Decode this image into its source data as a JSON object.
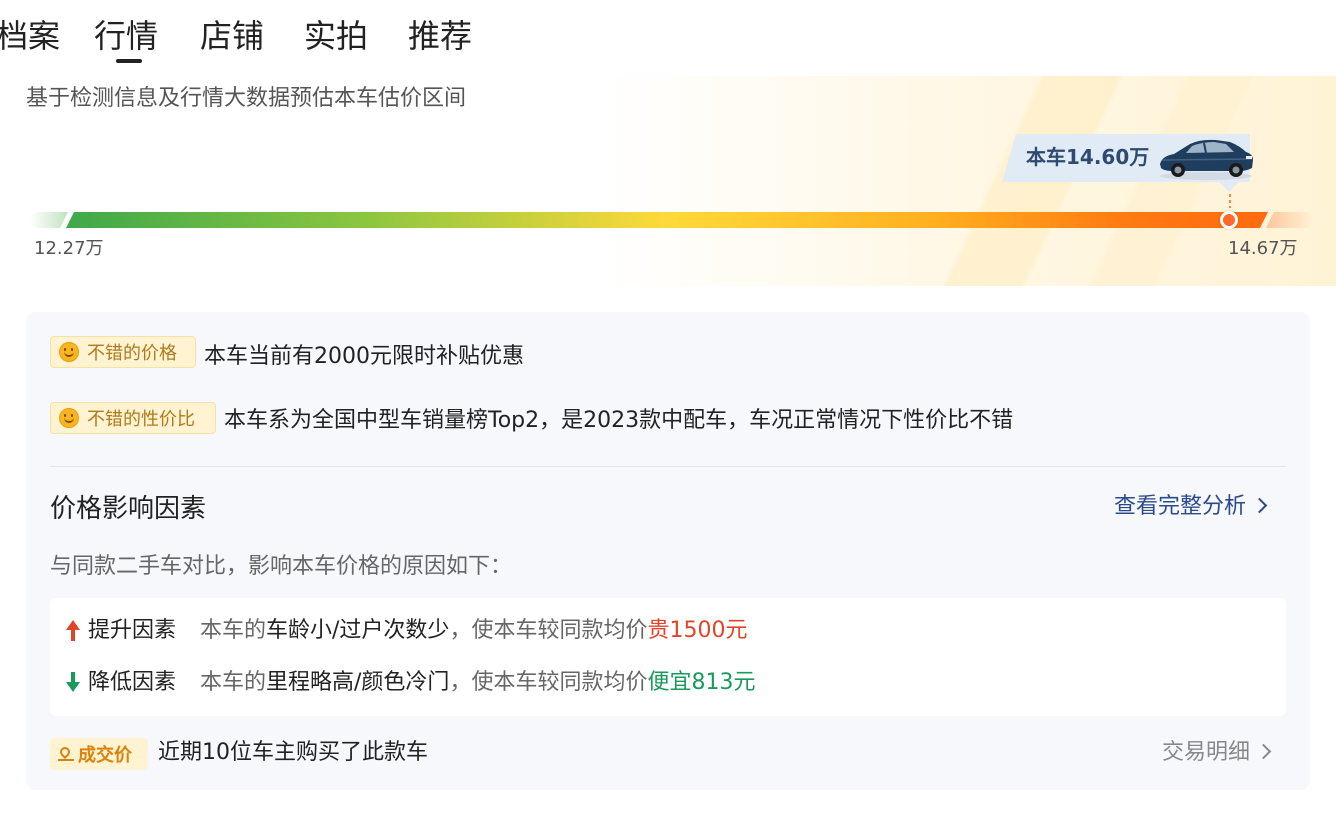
{
  "tabs": [
    "档案",
    "行情",
    "店铺",
    "实拍",
    "推荐"
  ],
  "active_tab": "行情",
  "estimate": {
    "description": "基于检测信息及行情大数据预估本车估价区间",
    "car_price_label": "本车14.60万",
    "range_min": "12.27万",
    "range_max": "14.67万",
    "car_price_position": 0.97
  },
  "highlights": [
    {
      "tag": "不错的价格",
      "text": "本车当前有2000元限时补贴优惠"
    },
    {
      "tag": "不错的性价比",
      "text": "本车系为全国中型车销量榜Top2，是2023款中配车，车况正常情况下性价比不错"
    }
  ],
  "factors": {
    "title": "价格影响因素",
    "link": "查看完整分析",
    "description": "与同款二手车对比，影响本车价格的原因如下：",
    "up": {
      "label": "提升因素",
      "prefix": "本车的",
      "items": "车龄小/过户次数少",
      "middle": "，使本车较同款均价",
      "result": "贵1500元"
    },
    "down": {
      "label": "降低因素",
      "prefix": "本车的",
      "items": "里程略高/颜色冷门",
      "middle": "，使本车较同款均价",
      "result": "便宜813元"
    }
  },
  "deal": {
    "tag": "成交价",
    "text": "近期10位车主购买了此款车",
    "link": "交易明细"
  },
  "colors": {
    "accent_orange": "#ff6a10",
    "up_red": "#e0442a",
    "down_green": "#1a9a5a",
    "link_blue": "#2a4a8c"
  }
}
